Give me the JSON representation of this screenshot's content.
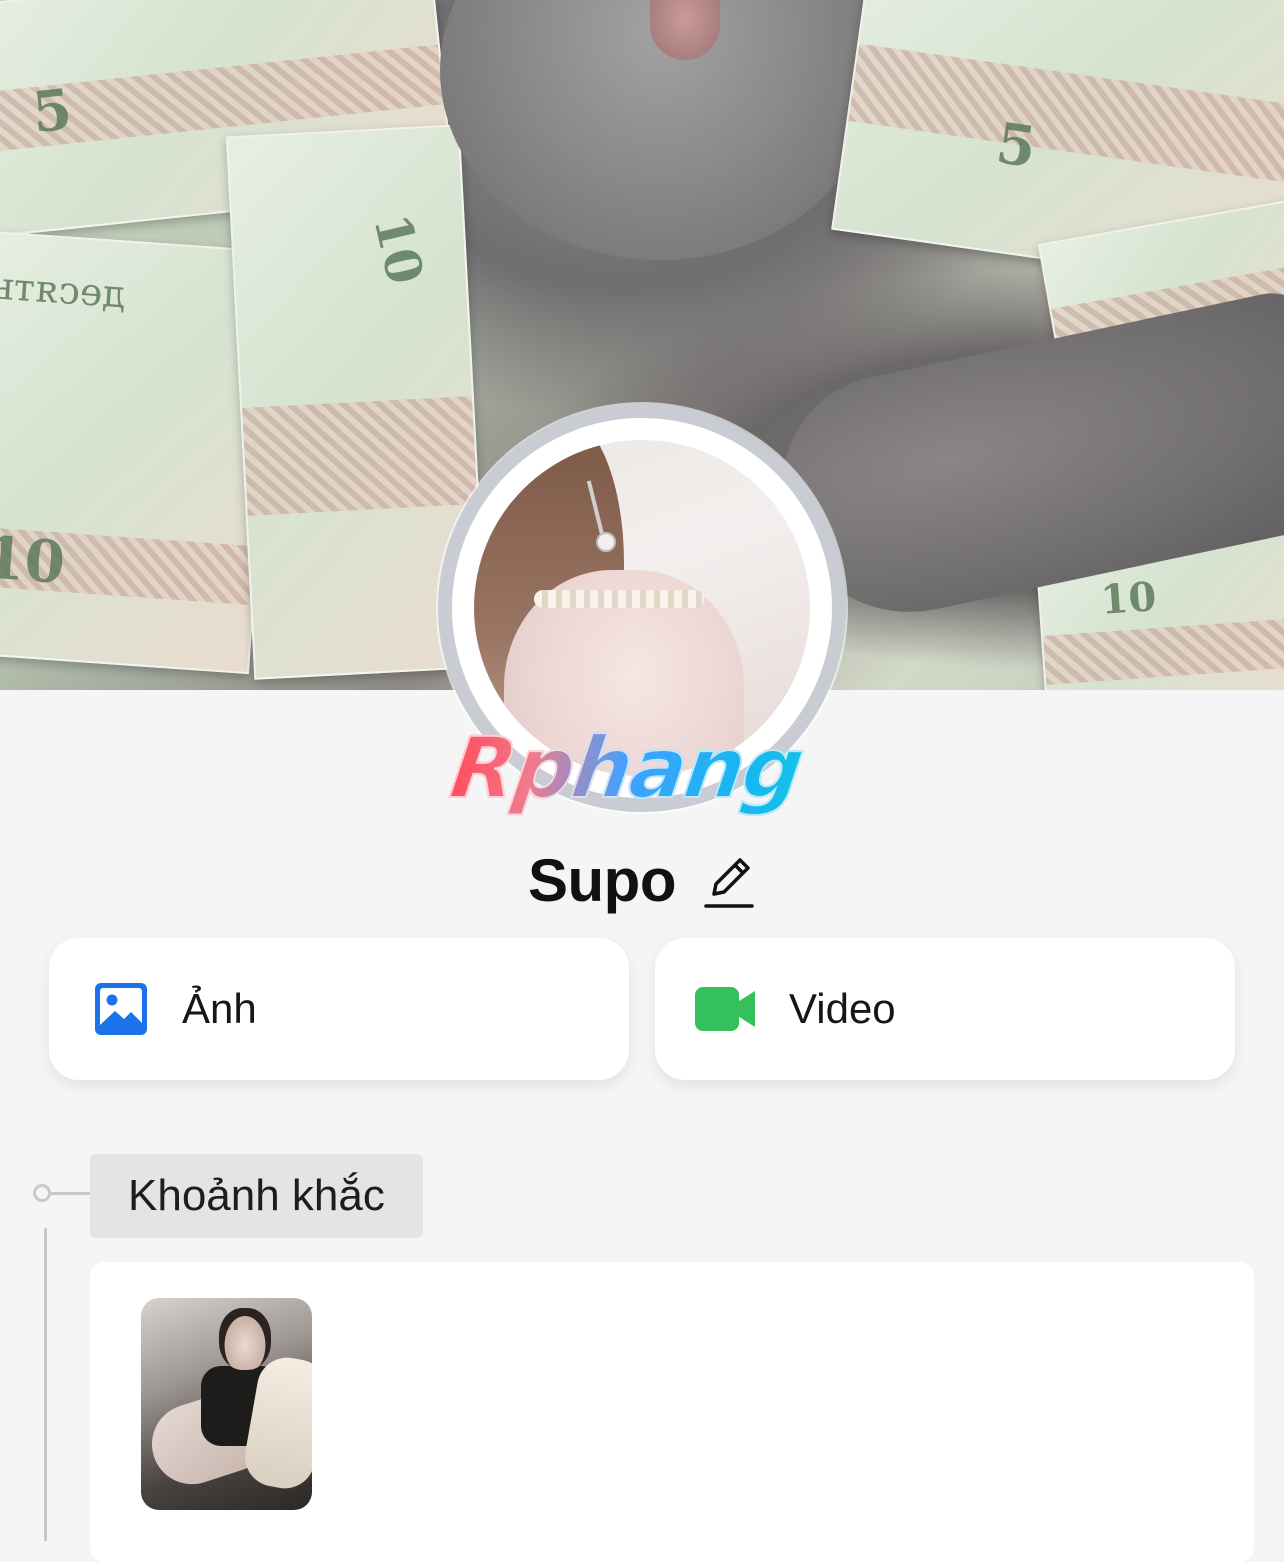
{
  "profile": {
    "name": "Supo"
  },
  "watermark": {
    "text": "Rphang"
  },
  "actions": {
    "photo_label": "Ảnh",
    "video_label": "Video"
  },
  "colors": {
    "photo_icon": "#1a73e8",
    "video_icon": "#34c05a",
    "background": "#f5f5f6"
  },
  "icons": {
    "edit": "pencil-icon",
    "photo": "photo-icon",
    "video": "video-camera-icon"
  },
  "cover": {
    "bill_numbers": [
      "5",
      "10",
      "10",
      "5",
      "10"
    ],
    "bill_text": "десять"
  },
  "moments": {
    "section_label": "Khoảnh khắc"
  }
}
